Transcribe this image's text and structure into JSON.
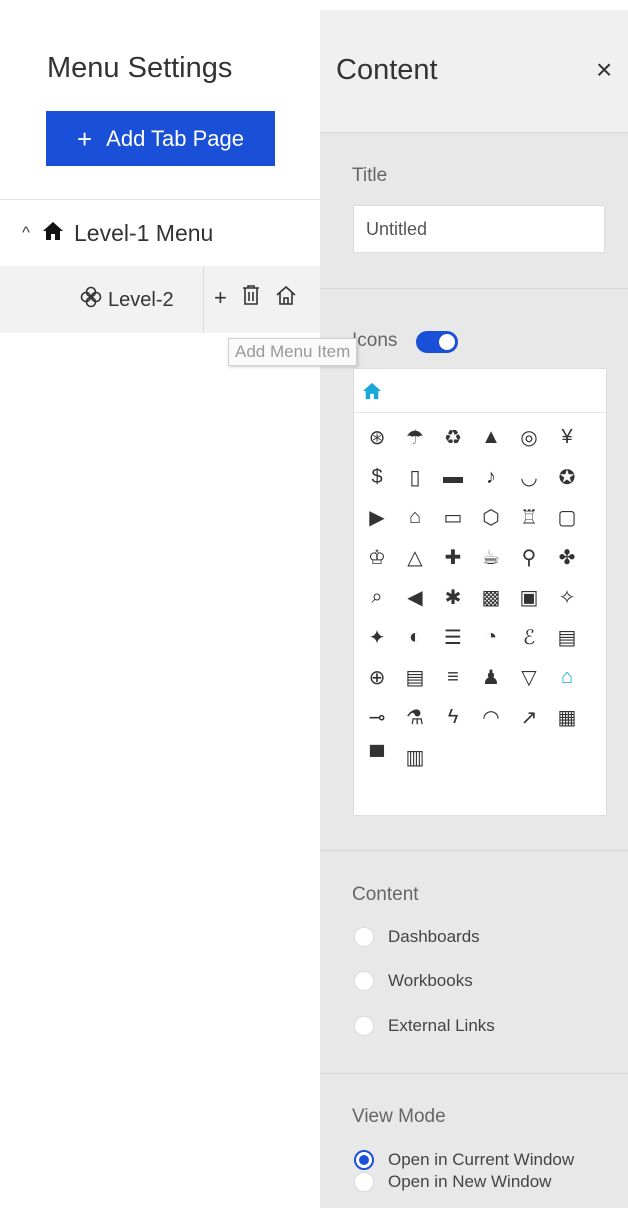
{
  "left": {
    "title": "Menu Settings",
    "add_tab_label": "Add Tab Page",
    "level1_label": "Level-1 Menu",
    "level2_label": "Level-2",
    "tooltip": "Add Menu Item"
  },
  "panel": {
    "title": "Content",
    "close_glyph": "×",
    "title_label": "Title",
    "title_value": "Untitled",
    "icons_label": "Icons",
    "icons_enabled": true,
    "selected_icon": "home-icon",
    "icons": [
      {
        "name": "basketball-icon",
        "glyph": "⊛"
      },
      {
        "name": "umbrella-icon",
        "glyph": "☂"
      },
      {
        "name": "recycle-icon",
        "glyph": "♻"
      },
      {
        "name": "mountain-icon",
        "glyph": "▲"
      },
      {
        "name": "disc-icon",
        "glyph": "◎"
      },
      {
        "name": "yen-coin-icon",
        "glyph": "¥"
      },
      {
        "name": "money-bag-icon",
        "glyph": "$"
      },
      {
        "name": "mobile-icon",
        "glyph": "▯"
      },
      {
        "name": "live-icon",
        "glyph": "▬"
      },
      {
        "name": "music-icon",
        "glyph": "♪"
      },
      {
        "name": "bear-icon",
        "glyph": "◡"
      },
      {
        "name": "star-circle-icon",
        "glyph": "✪"
      },
      {
        "name": "film-icon",
        "glyph": "▶"
      },
      {
        "name": "backpack-icon",
        "glyph": "⌂"
      },
      {
        "name": "laptop-icon",
        "glyph": "▭"
      },
      {
        "name": "box-icon",
        "glyph": "⬡"
      },
      {
        "name": "shirt-icon",
        "glyph": "♖"
      },
      {
        "name": "window-icon",
        "glyph": "▢"
      },
      {
        "name": "chef-hat-icon",
        "glyph": "♔"
      },
      {
        "name": "dress-icon",
        "glyph": "△"
      },
      {
        "name": "gamepad-icon",
        "glyph": "✚"
      },
      {
        "name": "cup-icon",
        "glyph": "☕"
      },
      {
        "name": "cutlery-icon",
        "glyph": "⚲"
      },
      {
        "name": "clover-icon",
        "glyph": "✤"
      },
      {
        "name": "doc-search-icon",
        "glyph": "⌕"
      },
      {
        "name": "megaphone-icon",
        "glyph": "◀"
      },
      {
        "name": "asterisk-icon",
        "glyph": "✱"
      },
      {
        "name": "calendar-icon",
        "glyph": "▩"
      },
      {
        "name": "chart-frame-icon",
        "glyph": "▣"
      },
      {
        "name": "click-icon",
        "glyph": "✧"
      },
      {
        "name": "puzzle-icon",
        "glyph": "✦"
      },
      {
        "name": "toggle-icon",
        "glyph": "◐"
      },
      {
        "name": "database-icon",
        "glyph": "☰"
      },
      {
        "name": "speedometer-icon",
        "glyph": "◔"
      },
      {
        "name": "stethoscope-icon",
        "glyph": "ℰ"
      },
      {
        "name": "form-icon",
        "glyph": "▤"
      },
      {
        "name": "globe-icon",
        "glyph": "⊕"
      },
      {
        "name": "document-icon",
        "glyph": "▤"
      },
      {
        "name": "list-icon",
        "glyph": "≡"
      },
      {
        "name": "people-icon",
        "glyph": "♟"
      },
      {
        "name": "filter-icon",
        "glyph": "▽"
      },
      {
        "name": "home-icon",
        "glyph": "⌂",
        "selected": true
      },
      {
        "name": "commit-icon",
        "glyph": "⊸"
      },
      {
        "name": "flask-icon",
        "glyph": "⚗"
      },
      {
        "name": "lightning-icon",
        "glyph": "ϟ"
      },
      {
        "name": "gauge-icon",
        "glyph": "◠"
      },
      {
        "name": "growth-chart-icon",
        "glyph": "↗"
      },
      {
        "name": "grid-table-icon",
        "glyph": "▦"
      },
      {
        "name": "store-icon",
        "glyph": "▀"
      },
      {
        "name": "presentation-icon",
        "glyph": "▥"
      }
    ],
    "content_label": "Content",
    "content_options": [
      "Dashboards",
      "Workbooks",
      "External Links"
    ],
    "view_mode_label": "View Mode",
    "view_mode_options": [
      "Open in Current Window",
      "Open in New Window"
    ],
    "view_mode_selected": "Open in Current Window"
  },
  "colors": {
    "accent": "#1a4fd8",
    "selected_icon": "#17a8d8"
  }
}
